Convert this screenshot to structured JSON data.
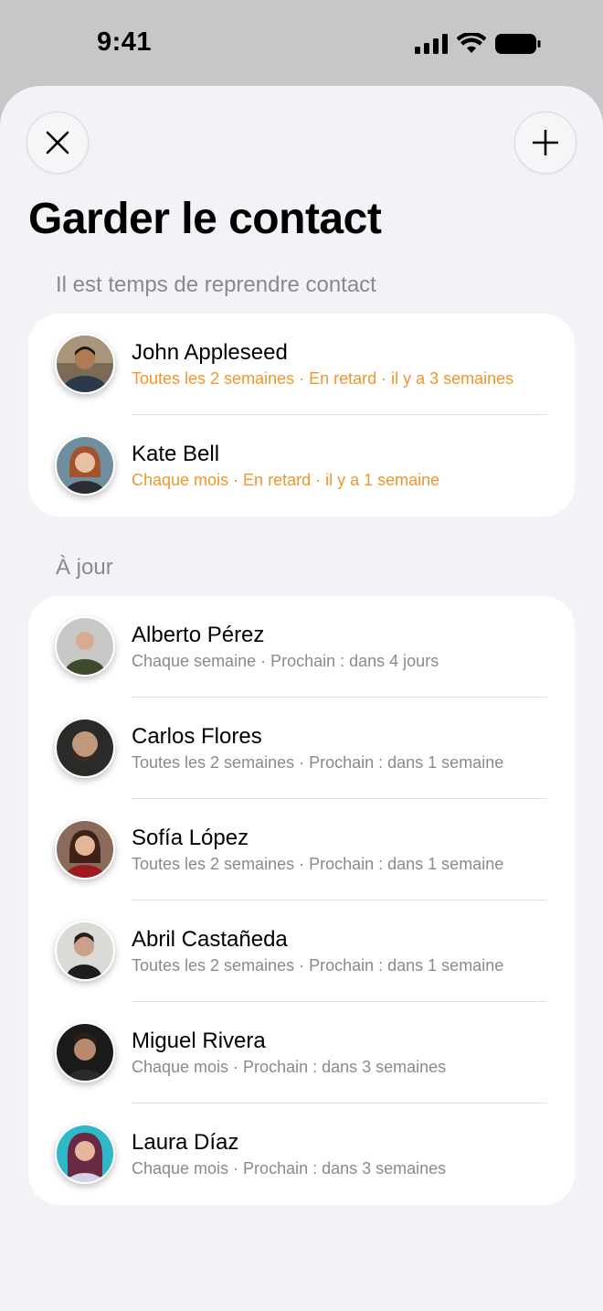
{
  "status_bar": {
    "time": "9:41"
  },
  "page": {
    "title": "Garder le contact"
  },
  "sections": [
    {
      "header": "Il est temps de reprendre contact",
      "contacts": [
        {
          "name": "John Appleseed",
          "detail": "Toutes les 2 semaines · En retard · il y a 3 semaines"
        },
        {
          "name": "Kate Bell",
          "detail": "Chaque mois · En retard · il y a 1 semaine"
        }
      ]
    },
    {
      "header": "À jour",
      "contacts": [
        {
          "name": "Alberto Pérez",
          "detail": "Chaque semaine · Prochain : dans 4 jours"
        },
        {
          "name": "Carlos Flores",
          "detail": "Toutes les 2 semaines · Prochain : dans 1 semaine"
        },
        {
          "name": "Sofía López",
          "detail": "Toutes les 2 semaines · Prochain : dans 1 semaine"
        },
        {
          "name": "Abril Castañeda",
          "detail": "Toutes les 2 semaines · Prochain : dans 1 semaine"
        },
        {
          "name": "Miguel Rivera",
          "detail": "Chaque mois · Prochain : dans 3 semaines"
        },
        {
          "name": "Laura Díaz",
          "detail": "Chaque mois · Prochain : dans 3 semaines"
        }
      ]
    }
  ],
  "colors": {
    "overdue": "#f0962b",
    "secondary": "#8a8a8e",
    "sheet_bg": "#f2f2f7"
  },
  "icons": {
    "close": "close-icon",
    "add": "plus-icon"
  }
}
